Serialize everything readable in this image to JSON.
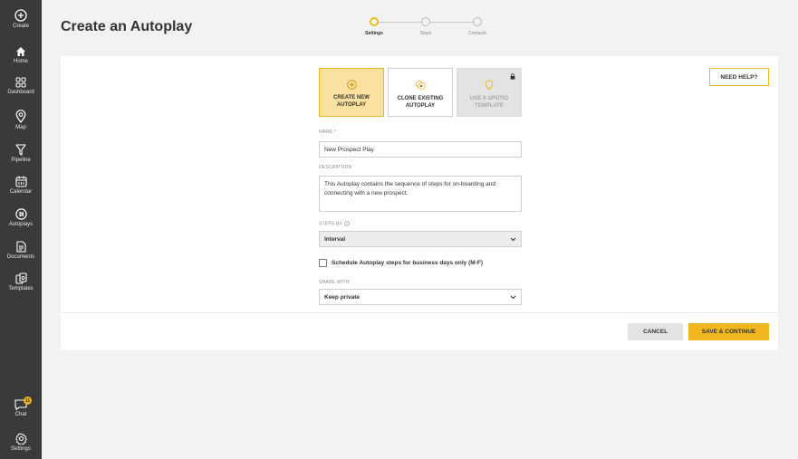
{
  "sidebar": {
    "items": [
      {
        "label": "Create",
        "icon": "plus-circle-icon"
      },
      {
        "label": "Home",
        "icon": "home-icon"
      },
      {
        "label": "Dashboard",
        "icon": "dashboard-icon"
      },
      {
        "label": "Map",
        "icon": "map-pin-icon"
      },
      {
        "label": "Pipeline",
        "icon": "funnel-icon"
      },
      {
        "label": "Calendar",
        "icon": "calendar-icon"
      },
      {
        "label": "Autoplays",
        "icon": "autoplay-icon"
      },
      {
        "label": "Documents",
        "icon": "document-icon"
      },
      {
        "label": "Templates",
        "icon": "templates-icon"
      }
    ],
    "chat": {
      "label": "Chat",
      "badge": "11"
    },
    "settings": {
      "label": "Settings"
    }
  },
  "header": {
    "title": "Create an Autoplay",
    "steps": [
      {
        "label": "Settings",
        "active": true
      },
      {
        "label": "Steps",
        "active": false
      },
      {
        "label": "Contacts",
        "active": false
      }
    ]
  },
  "help_button": "NEED HELP?",
  "options": [
    {
      "label": "CREATE NEW AUTOPLAY",
      "state": "selected"
    },
    {
      "label": "CLONE EXISTING AUTOPLAY",
      "state": "normal"
    },
    {
      "label": "USE A SPOTIO TEMPLATE",
      "state": "disabled"
    }
  ],
  "form": {
    "name_label": "NAME",
    "name_required_mark": "*",
    "name_value": "New Prospect Play",
    "description_label": "DESCRIPTION",
    "description_value": "This Autoplay contains the sequence of steps for on-boarding and connecting with a new prospect.",
    "steps_by_label": "STEPS BY",
    "steps_by_value": "Interval",
    "business_days_label": "Schedule Autoplay steps for business days only (M-F)",
    "share_with_label": "SHARE WITH",
    "share_with_value": "Keep private"
  },
  "actions": {
    "cancel": "CANCEL",
    "save": "SAVE & CONTINUE"
  },
  "colors": {
    "accent": "#f0b81e",
    "sidebar": "#3a3a3a",
    "selected_bg": "#fbe1a0"
  }
}
